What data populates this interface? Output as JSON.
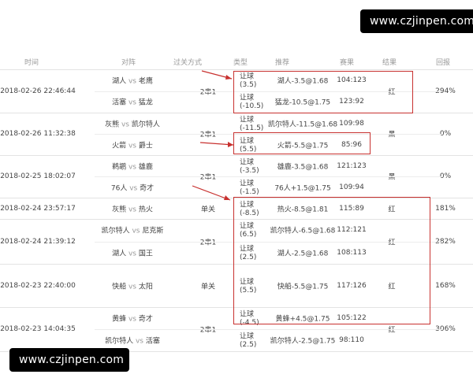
{
  "watermark_top": "www.czjinpen.com",
  "watermark_bottom": "www.czjinpen.com",
  "headers": [
    "时间",
    "对阵",
    "过关方式",
    "类型",
    "推荐",
    "赛果",
    "结果",
    "回报"
  ],
  "groups": [
    {
      "time": "2018-02-26 22:46:44",
      "parlay": "2串1",
      "result": "红",
      "return": "294%",
      "games": [
        {
          "home": "湖人",
          "away": "老鹰",
          "type": "让球",
          "line": "(3.5)",
          "pick": "湖人-3.5@1.68",
          "score": "104:123"
        },
        {
          "home": "活塞",
          "away": "猛龙",
          "type": "让球",
          "line": "(-10.5)",
          "pick": "猛龙-10.5@1.75",
          "score": "123:92"
        }
      ]
    },
    {
      "time": "2018-02-26 11:32:38",
      "parlay": "2串1",
      "result": "黑",
      "return": "0%",
      "games": [
        {
          "home": "灰熊",
          "away": "凯尔特人",
          "type": "让球",
          "line": "(-11.5)",
          "pick": "凯尔特人-11.5@1.68",
          "score": "109:98"
        },
        {
          "home": "火箭",
          "away": "爵士",
          "type": "让球",
          "line": "(5.5)",
          "pick": "火箭-5.5@1.75",
          "score": "85:96"
        }
      ]
    },
    {
      "time": "2018-02-25 18:02:07",
      "parlay": "2串1",
      "result": "黑",
      "return": "0%",
      "games": [
        {
          "home": "鹈鹕",
          "away": "雄鹿",
          "type": "让球",
          "line": "(-3.5)",
          "pick": "雄鹿-3.5@1.68",
          "score": "121:123"
        },
        {
          "home": "76人",
          "away": "奇才",
          "type": "让球",
          "line": "(-1.5)",
          "pick": "76人+1.5@1.75",
          "score": "109:94"
        }
      ]
    },
    {
      "time": "2018-02-24 23:57:17",
      "parlay": "单关",
      "result": "红",
      "return": "181%",
      "games": [
        {
          "home": "灰熊",
          "away": "热火",
          "type": "让球",
          "line": "(-8.5)",
          "pick": "热火-8.5@1.81",
          "score": "115:89"
        }
      ]
    },
    {
      "time": "2018-02-24 21:39:12",
      "parlay": "2串1",
      "result": "红",
      "return": "282%",
      "games": [
        {
          "home": "凯尔特人",
          "away": "尼克斯",
          "type": "让球",
          "line": "(6.5)",
          "pick": "凯尔特人-6.5@1.68",
          "score": "112:121"
        },
        {
          "home": "湖人",
          "away": "国王",
          "type": "让球",
          "line": "(2.5)",
          "pick": "湖人-2.5@1.68",
          "score": "108:113"
        }
      ]
    },
    {
      "time": "2018-02-23 22:40:00",
      "parlay": "单关",
      "result": "红",
      "return": "168%",
      "games": [
        {
          "home": "快船",
          "away": "太阳",
          "type": "让球",
          "line": "(5.5)",
          "pick": "快船-5.5@1.75",
          "score": "117:126"
        }
      ]
    },
    {
      "time": "2018-02-23 14:04:35",
      "parlay": "2串1",
      "result": "红",
      "return": "306%",
      "games": [
        {
          "home": "黄蜂",
          "away": "奇才",
          "type": "让球",
          "line": "(-4.5)",
          "pick": "黄蜂+4.5@1.75",
          "score": "105:122"
        },
        {
          "home": "凯尔特人",
          "away": "活塞",
          "type": "让球",
          "line": "(2.5)",
          "pick": "凯尔特人-2.5@1.75",
          "score": "98:110"
        }
      ]
    }
  ],
  "vs_label": "vs",
  "colors": {
    "highlight_box": "#c8312f",
    "text": "#444444",
    "header_text": "#999999",
    "divider": "#e3e3e3"
  }
}
